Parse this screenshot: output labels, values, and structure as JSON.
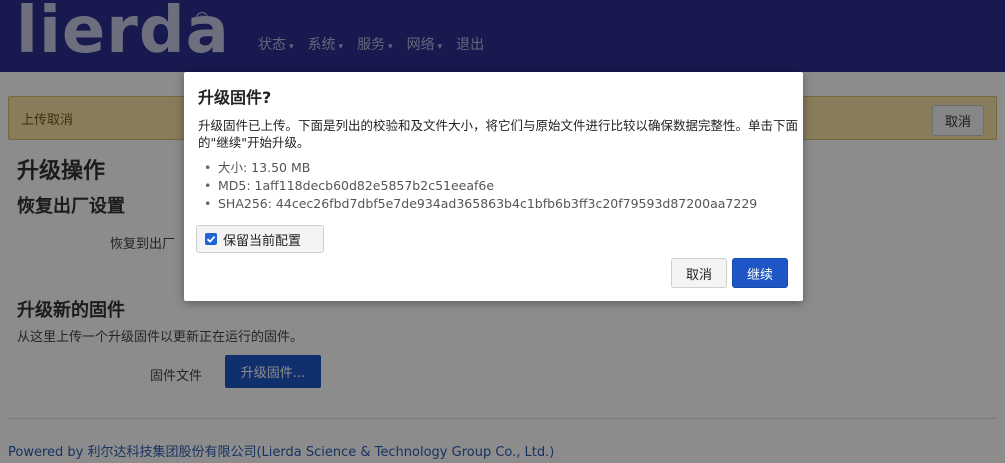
{
  "logo": {
    "text": "lierda",
    "reg": "®"
  },
  "nav": [
    {
      "label": "状态",
      "caret": "▾"
    },
    {
      "label": "系统",
      "caret": "▾"
    },
    {
      "label": "服务",
      "caret": "▾"
    },
    {
      "label": "网络",
      "caret": "▾"
    },
    {
      "label": "退出",
      "caret": ""
    }
  ],
  "alert": {
    "text": "上传取消",
    "cancel_label": "取消"
  },
  "main": {
    "title": "升级操作",
    "restore_heading": "恢复出厂设置",
    "restore_label": "恢复到出厂",
    "upgrade_heading": "升级新的固件",
    "upgrade_desc": "从这里上传一个升级固件以更新正在运行的固件。",
    "file_label": "固件文件",
    "file_button": "升级固件..."
  },
  "footer": "Powered by 利尔达科技集团股份有限公司(Lierda Science & Technology Group Co., Ltd.)",
  "modal": {
    "title": "升级固件?",
    "desc": "升级固件已上传。下面是列出的校验和及文件大小，将它们与原始文件进行比较以确保数据完整性。单击下面的\"继续\"开始升级。",
    "items": [
      "大小: 13.50 MB",
      "MD5: 1aff118decb60d82e5857b2c51eeaf6e",
      "SHA256: 44cec26fbd7dbf5e7de934ad365863b4c1bfb6b3ff3c20f79593d87200aa7229"
    ],
    "keep_config_label": "保留当前配置",
    "keep_config_checked": true,
    "cancel_label": "取消",
    "continue_label": "继续"
  },
  "colors": {
    "topbar": "#2c2f8e",
    "primary_button": "#1e56c6",
    "alert_bg": "#f6e3a6"
  }
}
